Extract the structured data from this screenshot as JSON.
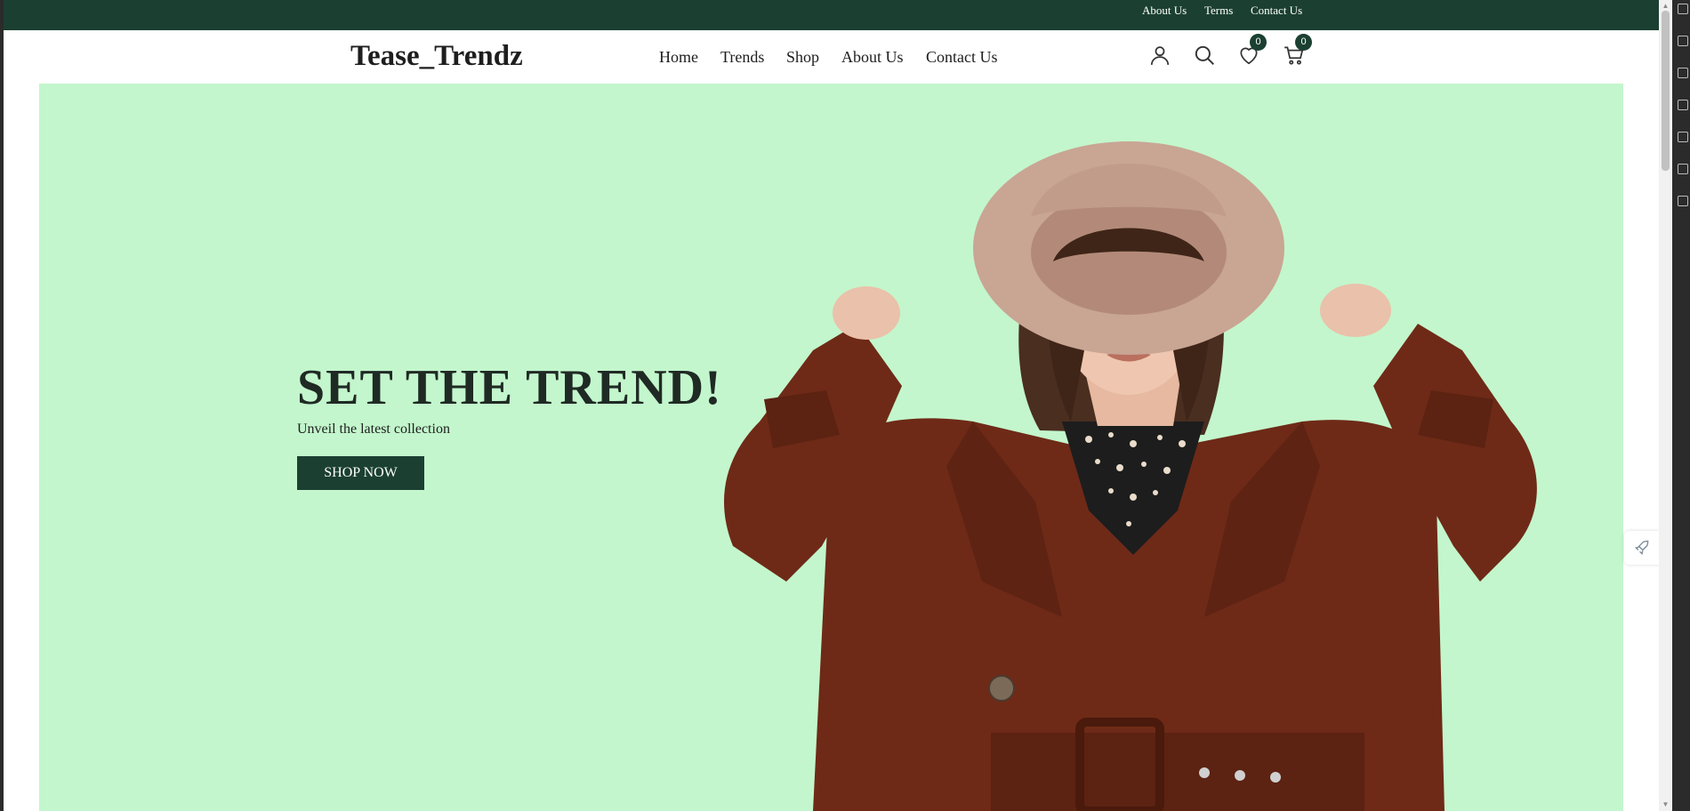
{
  "topbar": {
    "links": [
      "About Us",
      "Terms",
      "Contact Us"
    ]
  },
  "header": {
    "brand": "Tease_Trendz",
    "nav": [
      "Home",
      "Trends",
      "Shop",
      "About Us",
      "Contact Us"
    ],
    "icons": [
      "user-icon",
      "search-icon",
      "heart-icon",
      "cart-icon"
    ],
    "wishlist_count": "0",
    "cart_count": "0"
  },
  "hero": {
    "title": "SET THE TREND!",
    "subtitle": "Unveil the latest collection",
    "button": "SHOP NOW"
  },
  "colors": {
    "brand_dark_green": "#1b4032",
    "hero_bg": "#c3f6cc",
    "coat": "#6e2a17",
    "hat": "#c9a594"
  }
}
